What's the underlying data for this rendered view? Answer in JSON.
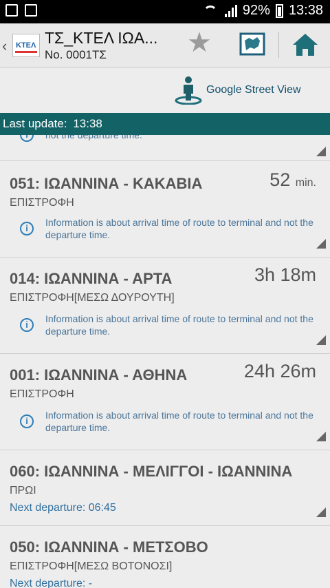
{
  "status_bar": {
    "battery": "92%",
    "time": "13:38"
  },
  "app_bar": {
    "title": "ΤΣ_ΚΤΕΛ ΙΩΑ...",
    "stop_no": "No. 0001ΤΣ",
    "logo_text": "KTEΛ"
  },
  "street_view": {
    "label": "Google Street View"
  },
  "update": {
    "label": "Last update:",
    "time": "13:38"
  },
  "partial_top": {
    "info": "not the departure time."
  },
  "routes": [
    {
      "title": "051: ΙΩΑΝΝΙΝΑ - ΚΑΚΑΒΙΑ",
      "eta": "52",
      "eta_unit": "min.",
      "variant": "ΕΠΙΣΤΡΟΦΗ",
      "info": "Information is about arrival time of route to terminal and not the departure time."
    },
    {
      "title": "014: ΙΩΑΝΝΙΝΑ - ΑΡΤΑ",
      "eta": "3h 18m",
      "variant": "ΕΠΙΣΤΡΟΦΗ[ΜΕΣΩ ΔΟΥΡΟΥΤΗ]",
      "info": "Information is about arrival time of route to terminal and not the departure time."
    },
    {
      "title": "001: ΙΩΑΝΝΙΝΑ - ΑΘΗΝΑ",
      "eta": "24h 26m",
      "variant": "ΕΠΙΣΤΡΟΦΗ",
      "info": "Information is about arrival time of route to terminal and not the departure time."
    },
    {
      "title": "060: ΙΩΑΝΝΙΝΑ - ΜΕΛΙΓΓΟΙ - ΙΩΑΝΝΙΝΑ",
      "variant": "ΠΡΩΙ",
      "next_label": "Next departure:",
      "next_value": "06:45"
    },
    {
      "title": "050: ΙΩΑΝΝΙΝΑ - ΜΕΤΣΟΒΟ",
      "variant": "ΕΠΙΣΤΡΟΦΗ[ΜΕΣΩ ΒΟΤΟΝΟΣΙ]",
      "next_label": "Next departure:",
      "next_value": "-"
    }
  ],
  "colors": {
    "update_bar": "#136266",
    "info_blue": "#2f7eb8",
    "title_gray": "#555555"
  }
}
